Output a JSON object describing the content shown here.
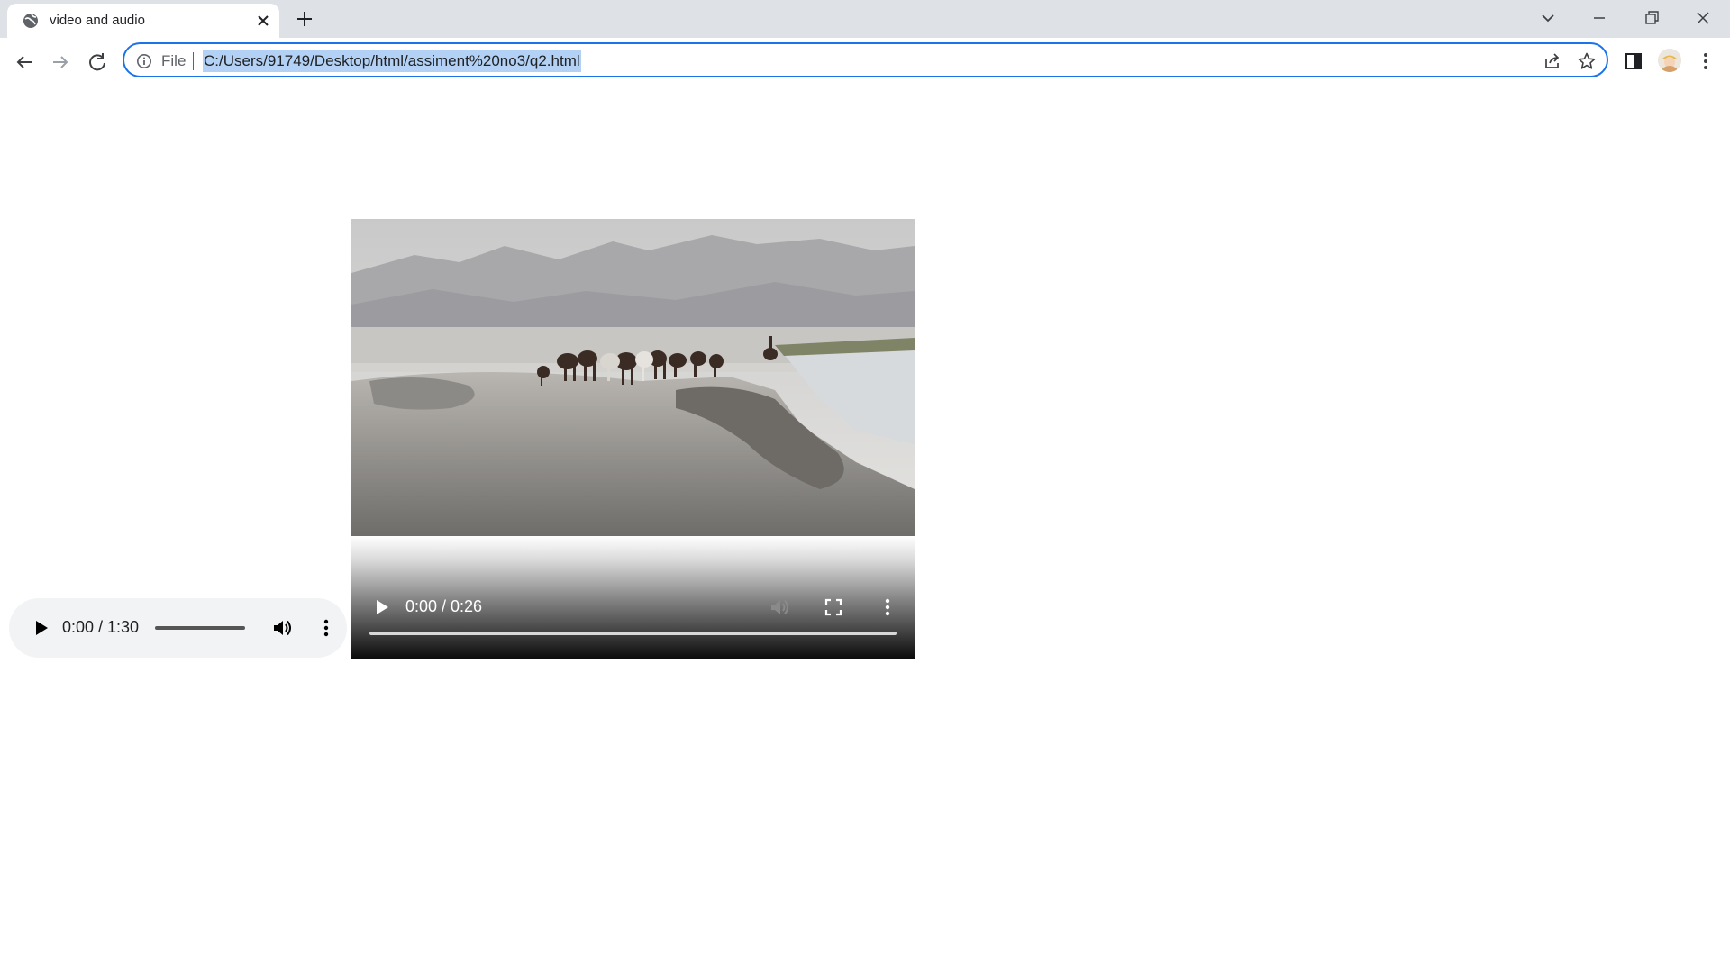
{
  "browser": {
    "tab": {
      "title": "video and audio",
      "favicon": "globe-icon"
    },
    "address_bar": {
      "scheme_label": "File",
      "url": "C:/Users/91749/Desktop/html/assiment%20no3/q2.html"
    }
  },
  "page": {
    "audio": {
      "time": "0:00 / 1:30"
    },
    "video": {
      "time": "0:00 / 0:26"
    }
  },
  "colors": {
    "tabstrip": "#dee1e6",
    "focus_ring": "#1a73e8",
    "url_selection": "#b3d1f5",
    "audio_bg": "#f1f3f4"
  }
}
